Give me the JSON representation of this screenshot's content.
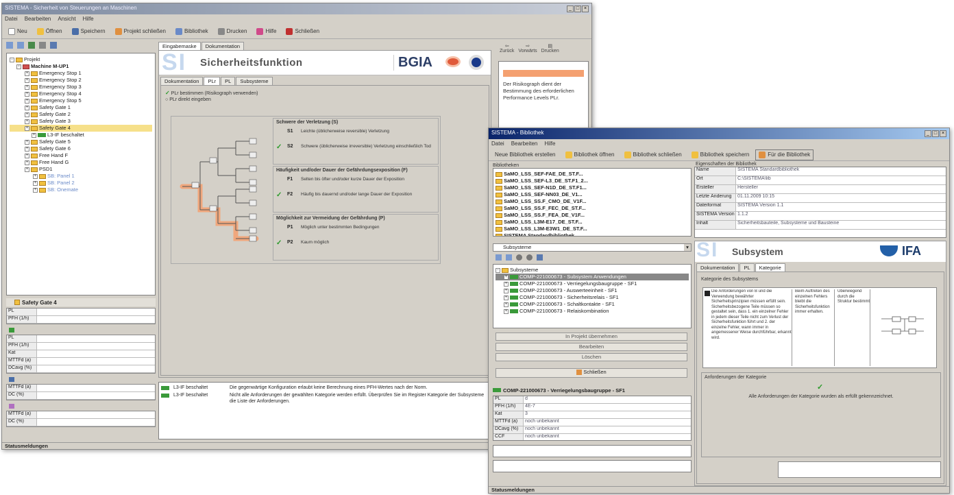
{
  "colors": {
    "accent": "#0a246a",
    "check": "#2a9a2a",
    "folder": "#f0c040",
    "risk_path": "#f4a070",
    "logo_blue": "#2360a8"
  },
  "win1": {
    "title": "SISTEMA - Sicherheit von Steuerungen an Maschinen",
    "menu": [
      "Datei",
      "Bearbeiten",
      "Ansicht",
      "Hilfe"
    ],
    "toolbar": [
      "Neu",
      "Öffnen",
      "Speichern",
      "Projekt schließen",
      "Bibliothek",
      "Drucken",
      "Hilfe",
      "Schließen"
    ],
    "tree": {
      "root": "Projekt",
      "machine": "Machine M-UP1",
      "items": [
        "Emergency Stop 1",
        "Emergency Stop 2",
        "Emergency Stop 3",
        "Emergency Stop 4",
        "Emergency Stop 5",
        "Safety Gate 1",
        "Safety Gate 2",
        "Safety Gate 3",
        "Safety Gate 4",
        "L3-IF beschaltet",
        "Safety Gate 5",
        "Safety Gate 6",
        "Free Hand F",
        "Free Hand G",
        "PSD1",
        "SB: Panel 1",
        "SB: Panel 2",
        "SB: Onemate"
      ],
      "selected_index": 8
    },
    "bottom_title": "Safety Gate 4",
    "field_labels": [
      "PL",
      "PFH (1/h)",
      "PL",
      "PFH (1/h)",
      "Kat",
      "MTTFd (a)",
      "DCavg (%)",
      "MTTFd (a)",
      "DC (%)",
      "MTTFd (a)",
      "DC (%)"
    ],
    "statusbar": "Statusmeldungen",
    "tabs": [
      "Eingabemaske",
      "Dokumentation"
    ],
    "banner_title": "Sicherheitsfunktion",
    "banner_logo": "BGIA",
    "subtabs": [
      "Dokumentation",
      "PLr",
      "PL",
      "Subsysteme"
    ],
    "radio_1": "PLr bestimmen (Risikograph verwenden)",
    "radio_2": "PLr direkt eingeben",
    "risk_params": [
      {
        "title": "Schwere der Verletzung (S)",
        "options": [
          {
            "code": "S1",
            "text": "Leichte (üblicherweise reversible) Verletzung",
            "checked": false
          },
          {
            "code": "S2",
            "text": "Schwere (üblicherweise irreversible) Verletzung einschließlich Tod",
            "checked": true
          }
        ]
      },
      {
        "title": "Häufigkeit und/oder Dauer der Gefährdungsexposition (F)",
        "options": [
          {
            "code": "F1",
            "text": "Selten bis öfter und/oder kurze Dauer der Exposition",
            "checked": false
          },
          {
            "code": "F2",
            "text": "Häufig bis dauernd und/oder lange Dauer der Exposition",
            "checked": true
          }
        ]
      },
      {
        "title": "Möglichkeit zur Vermeidung der Gefährdung (P)",
        "options": [
          {
            "code": "P1",
            "text": "Möglich unter bestimmten Bedingungen",
            "checked": false
          },
          {
            "code": "P2",
            "text": "Kaum möglich",
            "checked": true
          }
        ]
      }
    ],
    "messages": [
      {
        "source": "L3-IF beschaltet",
        "text": "Die gegenwärtige Konfiguration erlaubt keine Berechnung eines PFH-Wertes nach der Norm."
      },
      {
        "source": "L3-IF beschaltet",
        "text": "Nicht alle Anforderungen der gewählten Kategorie werden erfüllt. Überprüfen Sie im Register Kategorie der Subsysteme die Liste der Anforderungen."
      }
    ],
    "right_buttons": [
      "Zurück",
      "Vorwärts",
      "Drucken"
    ],
    "help_text": "Der Risikograph dient der Bestimmung des erforderlichen Performance Levels PLr."
  },
  "win2": {
    "title": "SISTEMA - Bibliothek",
    "menu": [
      "Datei",
      "Bearbeiten",
      "Hilfe"
    ],
    "toolbar": [
      "Neue Bibliothek erstellen",
      "Bibliothek öffnen",
      "Bibliothek schließen",
      "Bibliothek speichern",
      "Für die Bibliothek"
    ],
    "lib_label": "Bibliotheken",
    "lib_files": [
      "SaMO_LSS_SEF-FAE_DE_ST.F...",
      "SaMO_LSS_SEF-L3_DE_ST.F1_2...",
      "SaMO_LSS_SEF-N1D_DE_ST.F1...",
      "SaMO_LSS_SEF-NN03_DE_V1...",
      "SaMO_LSS_SS.F_CMO_DE_V1F...",
      "SaMO_LSS_SS.F_FEC_DE_ST.F...",
      "SaMO_LSS_SS.F_FEA_DE_V1F...",
      "SaMO_LSS_L3M-E17_DE_ST.F...",
      "SaMO_LSS_L3M-E3W1_DE_ST.F...",
      "SISTEMA Standardbibliothek"
    ],
    "props_label": "Eigenschaften der Bibliothek",
    "props": [
      {
        "k": "Name",
        "v": "SISTEMA Standardbibliothek"
      },
      {
        "k": "Ort",
        "v": "C:\\SISTEMA\\lib"
      },
      {
        "k": "Ersteller",
        "v": "Hersteller"
      },
      {
        "k": "Letzte Änderung",
        "v": "01.11.2009 10:15"
      },
      {
        "k": "Dateiformat",
        "v": "SISTEMA Version 1.1"
      },
      {
        "k": "SISTEMA Version",
        "v": "1.1.2"
      },
      {
        "k": "Inhalt",
        "v": "Sicherheitsbauteile, Subsysteme und Bausteine"
      }
    ],
    "dropdown": "Subsysteme",
    "tree_root": "Subsysteme",
    "tree_items": [
      "COMP-221000673 - Subsystem Anwendungen",
      "COMP-221000673 - Verriegelungsbaugruppe - SF1",
      "COMP-221000673 - Auswerteeinheit - SF1",
      "COMP-221000673 - Sicherheitsrelais - SF1",
      "COMP-221000673 - Schaltkontakte - SF1",
      "COMP-221000673 - Relaiskombination"
    ],
    "action_buttons": [
      "In Projekt übernehmen",
      "Bearbeiten",
      "Löschen"
    ],
    "schliessen": "Schließen",
    "detail_title": "COMP-221000673 - Verriegelungsbaugruppe - SF1",
    "detail_labels": [
      "PL",
      "PFH (1/h)",
      "Kat",
      "MTTFd (a)",
      "DCavg (%)",
      "CCF"
    ],
    "detail_values": [
      "d",
      "4E-7",
      "3",
      "noch unbekannt",
      "noch unbekannt",
      "noch unbekannt"
    ],
    "statusbar": "Statusmeldungen",
    "banner_title": "Subsystem",
    "banner_logo": "IFA",
    "subtabs": [
      "Dokumentation",
      "PL",
      "Kategorie"
    ],
    "category_title": "Kategorie des Subsystems",
    "cat_desc": "Die Anforderungen von B und die Verwendung bewährter Sicherheitsprinzipien müssen erfüllt sein. Sicherheitsbezogene Teile müssen so gestaltet sein, dass 1. ein einzelner Fehler in jedem dieser Teile nicht zum Verlust der Sicherheitsfunktion führt und 2. der einzelne Fehler, wann immer in angemessener Weise durchführbar, erkannt wird.",
    "cat_col2": "Beim Auftreten des einzelnen Fehlers bleibt die Sicherheitsfunktion immer erhalten.",
    "cat_col3": "Überwiegend durch die Struktur bestimmt",
    "requirements_title": "Anforderungen der Kategorie",
    "requirements_text": "Alle Anforderungen der Kategorie wurden als erfüllt gekennzeichnet."
  }
}
